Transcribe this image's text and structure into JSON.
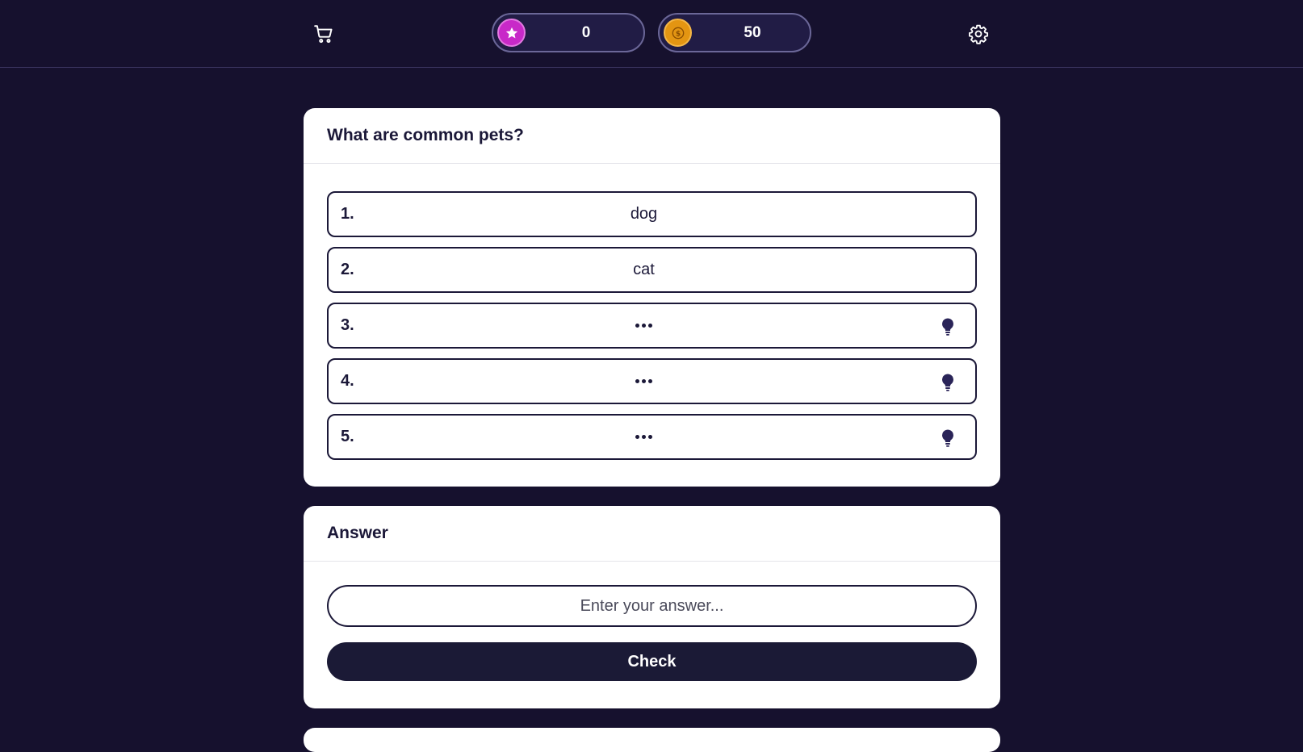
{
  "header": {
    "cart_icon": "cart-icon",
    "settings_icon": "gear-icon",
    "stars": {
      "icon": "star-icon",
      "value": "0",
      "color": "#c829c8"
    },
    "coins": {
      "icon": "coin-icon",
      "value": "50",
      "color": "#e39512"
    }
  },
  "question": {
    "title": "What are common pets?",
    "slots": [
      {
        "number": "1.",
        "word": "dog",
        "revealed": true
      },
      {
        "number": "2.",
        "word": "cat",
        "revealed": true
      },
      {
        "number": "3.",
        "revealed": false,
        "hint_icon": "lightbulb-icon"
      },
      {
        "number": "4.",
        "revealed": false,
        "hint_icon": "lightbulb-icon"
      },
      {
        "number": "5.",
        "revealed": false,
        "hint_icon": "lightbulb-icon"
      }
    ]
  },
  "answer": {
    "title": "Answer",
    "placeholder": "Enter your answer...",
    "value": "",
    "check_label": "Check"
  },
  "theme": {
    "background": "#16112e",
    "card": "#ffffff",
    "dark": "#1b1838"
  }
}
